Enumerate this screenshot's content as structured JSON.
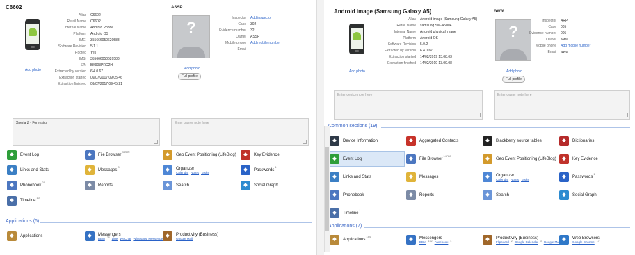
{
  "left": {
    "device_title": "C6602",
    "add_photo": "Add photo",
    "device_fields": [
      {
        "k": "Alias",
        "v": "C6602"
      },
      {
        "k": "Retail Name",
        "v": "C6602"
      },
      {
        "k": "Internal Name",
        "v": "Android Phone"
      },
      {
        "k": "Platform",
        "v": "Android OS"
      },
      {
        "k": "IMEI",
        "v": "355666050620588"
      },
      {
        "k": "Software Revision",
        "v": "5.1.1"
      },
      {
        "k": "Rooted",
        "v": "Yes"
      },
      {
        "k": "IMSI",
        "v": "355666050620588"
      },
      {
        "k": "S/N",
        "v": "BX903PRC2H"
      },
      {
        "k": "Extracted by version",
        "v": "6.4.0.67"
      },
      {
        "k": "Extraction started",
        "v": "09/07/2017 09.05.46"
      },
      {
        "k": "Extraction finished",
        "v": "09/07/2017 09.45.21"
      }
    ],
    "case_title": "ASSP",
    "case_fields": [
      {
        "k": "Inspector",
        "v": "Add inspector",
        "link": true
      },
      {
        "k": "Case",
        "v": "302",
        "link": false
      },
      {
        "k": "Evidence number",
        "v": "32",
        "link": false
      },
      {
        "k": "",
        "v": "",
        "link": false
      },
      {
        "k": "Owner",
        "v": "ASSP",
        "link": false
      },
      {
        "k": "Mobile phone",
        "v": "Add mobile number",
        "link": true
      },
      {
        "k": "Email",
        "v": "--",
        "link": false
      }
    ],
    "owner_add_photo": "Add photo",
    "full_profile": "Full profile",
    "device_note": "Xperia Z - Forensics",
    "owner_note": "Enter owner note here",
    "sections": [
      {
        "label": "Event Log",
        "count": "",
        "icon": "phone-icon",
        "color": "#2e9e3a"
      },
      {
        "label": "File Browser",
        "count": "34406",
        "icon": "file-browser-icon",
        "color": "#4c77c0"
      },
      {
        "label": "Geo Event Positioning (LifeBlog)",
        "count": "",
        "icon": "geo-icon",
        "color": "#d39a2c"
      },
      {
        "label": "Key Evidence",
        "count": "",
        "icon": "key-evidence-icon",
        "color": "#c0322b"
      },
      {
        "label": "Links and Stats",
        "count": "",
        "icon": "links-icon",
        "color": "#3b7fc4"
      },
      {
        "label": "Messages",
        "count": "3",
        "icon": "messages-icon",
        "color": "#e0b43a"
      },
      {
        "label": "Organizer",
        "count": "",
        "icon": "organizer-icon",
        "color": "#4e87d6",
        "subs": [
          {
            "t": "Calendar",
            "c": ""
          },
          {
            "t": "Notes",
            "c": ""
          },
          {
            "t": "Tasks",
            "c": ""
          }
        ]
      },
      {
        "label": "Passwords",
        "count": "1",
        "icon": "passwords-icon",
        "color": "#2a63c7"
      },
      {
        "label": "Phonebook",
        "count": "29",
        "icon": "phonebook-icon",
        "color": "#4c77c0"
      },
      {
        "label": "Reports",
        "count": "",
        "icon": "reports-icon",
        "color": "#7c8ba6"
      },
      {
        "label": "Search",
        "count": "",
        "icon": "search-icon",
        "color": "#6b95d8"
      },
      {
        "label": "Social Graph",
        "count": "",
        "icon": "social-graph-icon",
        "color": "#2d8bd0"
      },
      {
        "label": "Timeline",
        "count": "10",
        "icon": "timeline-icon",
        "color": "#4a6fa8"
      }
    ],
    "applications_header": "Applications (6)",
    "apps": [
      {
        "label": "Applications",
        "count": "",
        "icon": "applications-icon",
        "color": "#b98a3a"
      },
      {
        "label": "Messengers",
        "count": "",
        "icon": "messengers-icon",
        "color": "#3572c4",
        "subs": [
          {
            "t": "BBM",
            "c": "28"
          },
          {
            "t": "Line",
            "c": ""
          },
          {
            "t": "WeChat",
            "c": ""
          },
          {
            "t": "WhatsApp Messenger",
            "c": "32"
          }
        ]
      },
      {
        "label": "Productivity (Business)",
        "count": "",
        "icon": "productivity-icon",
        "color": "#a0672a",
        "subs": [
          {
            "t": "Google Mail",
            "c": ""
          }
        ]
      }
    ]
  },
  "right": {
    "device_title": "Android image (Samsung Galaxy A5)",
    "add_photo": "Add photo",
    "device_fields": [
      {
        "k": "Alias",
        "v": "Android image (Samsung Galaxy A5)"
      },
      {
        "k": "Retail Name",
        "v": "samsung SM-A500F"
      },
      {
        "k": "Internal Name",
        "v": "Android physical image"
      },
      {
        "k": "Platform",
        "v": "Android OS"
      },
      {
        "k": "Software Revision",
        "v": "5.0.2"
      },
      {
        "k": "Extracted by version",
        "v": "6.4.0.67"
      },
      {
        "k": "Extraction started",
        "v": "14/02/2019 13.08.03"
      },
      {
        "k": "Extraction finished",
        "v": "14/02/2019 13.09.08"
      }
    ],
    "case_title": "www",
    "case_fields": [
      {
        "k": "Inspector",
        "v": "ARP",
        "link": false
      },
      {
        "k": "Case",
        "v": "005",
        "link": false
      },
      {
        "k": "Evidence number",
        "v": "005",
        "link": false
      },
      {
        "k": "",
        "v": "",
        "link": false
      },
      {
        "k": "Owner",
        "v": "www",
        "link": false
      },
      {
        "k": "Mobile phone",
        "v": "Add mobile number",
        "link": true
      },
      {
        "k": "Email",
        "v": "www",
        "link": false
      }
    ],
    "owner_add_photo": "Add photo",
    "full_profile": "Full profile",
    "device_note": "Enter device note here",
    "owner_note": "Enter owner note here",
    "common_header": "Common sections (19)",
    "sections": [
      {
        "label": "Device Information",
        "count": "",
        "icon": "device-info-icon",
        "color": "#2f3a48"
      },
      {
        "label": "Aggregated Contacts",
        "count": "",
        "icon": "aggregated-contacts-icon",
        "color": "#c7332a"
      },
      {
        "label": "Blackberry source tables",
        "count": "",
        "icon": "blackberry-icon",
        "color": "#222222"
      },
      {
        "label": "Dictionaries",
        "count": "",
        "icon": "dictionaries-icon",
        "color": "#b52b2b"
      },
      {
        "label": "Event Log",
        "count": "",
        "icon": "phone-icon",
        "color": "#2e9e3a"
      },
      {
        "label": "File Browser",
        "count": "14728",
        "icon": "file-browser-icon",
        "color": "#4c77c0"
      },
      {
        "label": "Geo Event Positioning (LifeBlog)",
        "count": "",
        "icon": "geo-icon",
        "color": "#d39a2c"
      },
      {
        "label": "Key Evidence",
        "count": "",
        "icon": "key-evidence-icon",
        "color": "#c0322b"
      },
      {
        "label": "Links and Stats",
        "count": "",
        "icon": "links-icon",
        "color": "#3b7fc4"
      },
      {
        "label": "Messages",
        "count": "",
        "icon": "messages-icon",
        "color": "#e0b43a"
      },
      {
        "label": "Organizer",
        "count": "",
        "icon": "organizer-icon",
        "color": "#4e87d6",
        "subs": [
          {
            "t": "Calendar",
            "c": ""
          },
          {
            "t": "Notes",
            "c": ""
          },
          {
            "t": "Tasks",
            "c": ""
          }
        ]
      },
      {
        "label": "Passwords",
        "count": "1",
        "icon": "passwords-icon",
        "color": "#2a63c7"
      },
      {
        "label": "Phonebook",
        "count": "",
        "icon": "phonebook-icon",
        "color": "#4c77c0"
      },
      {
        "label": "Reports",
        "count": "",
        "icon": "reports-icon",
        "color": "#7c8ba6"
      },
      {
        "label": "Search",
        "count": "",
        "icon": "search-icon",
        "color": "#6b95d8"
      },
      {
        "label": "Social Graph",
        "count": "",
        "icon": "social-graph-icon",
        "color": "#2d8bd0"
      },
      {
        "label": "Timeline",
        "count": "1",
        "icon": "timeline-icon",
        "color": "#4a6fa8"
      }
    ],
    "applications_header": "Applications (7)",
    "apps": [
      {
        "label": "Applications",
        "count": "184",
        "icon": "applications-icon",
        "color": "#b98a3a"
      },
      {
        "label": "Messengers",
        "count": "",
        "icon": "messengers-icon",
        "color": "#3572c4",
        "subs": [
          {
            "t": "BBM",
            "c": "102"
          },
          {
            "t": "Facebook",
            "c": "4"
          }
        ]
      },
      {
        "label": "Productivity (Business)",
        "count": "",
        "icon": "productivity-icon",
        "color": "#a0672a",
        "subs": [
          {
            "t": "Flipboard",
            "c": "2"
          },
          {
            "t": "Google Calendar",
            "c": "3"
          },
          {
            "t": "Google Mail",
            "c": "17"
          }
        ]
      },
      {
        "label": "Web Browsers",
        "count": "",
        "icon": "web-browsers-icon",
        "color": "#2f78c8",
        "subs": [
          {
            "t": "Google Chrome",
            "c": "17"
          }
        ]
      }
    ]
  }
}
